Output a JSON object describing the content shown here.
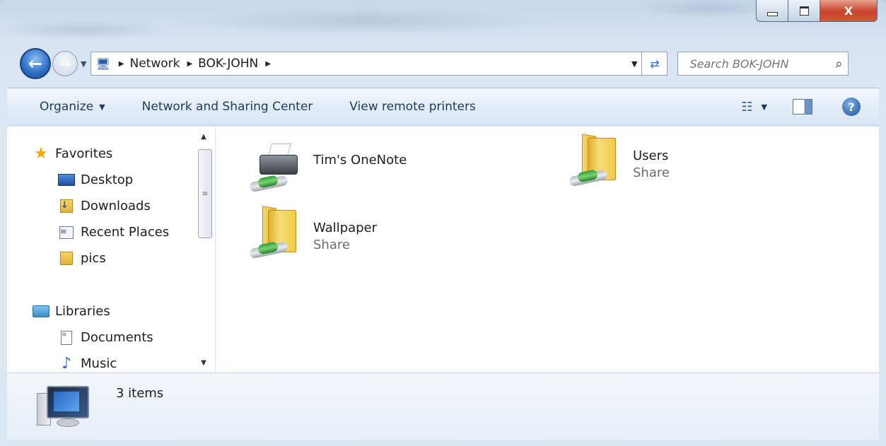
{
  "window": {
    "caption": {
      "minimize": "–",
      "maximize": "□",
      "close": "X"
    }
  },
  "navigation": {
    "breadcrumbs": [
      "Network",
      "BOK-JOHN"
    ],
    "search_placeholder": "Search BOK-JOHN"
  },
  "toolbar": {
    "organize": "Organize",
    "network_sharing": "Network and Sharing Center",
    "view_remote_printers": "View remote printers"
  },
  "sidebar": {
    "favorites": {
      "label": "Favorites",
      "items": [
        {
          "label": "Desktop",
          "icon": "desktop-icon"
        },
        {
          "label": "Downloads",
          "icon": "downloads-icon"
        },
        {
          "label": "Recent Places",
          "icon": "recent-places-icon"
        },
        {
          "label": "pics",
          "icon": "folder-icon"
        }
      ]
    },
    "libraries": {
      "label": "Libraries",
      "items": [
        {
          "label": "Documents",
          "icon": "documents-icon"
        },
        {
          "label": "Music",
          "icon": "music-icon"
        }
      ]
    }
  },
  "content": {
    "items": [
      {
        "name": "Tim's OneNote",
        "type": "",
        "icon": "network-printer-icon"
      },
      {
        "name": "Users",
        "type": "Share",
        "icon": "shared-folder-icon"
      },
      {
        "name": "Wallpaper",
        "type": "Share",
        "icon": "shared-folder-icon"
      }
    ]
  },
  "status": {
    "count": "3 items"
  },
  "colors": {
    "accent": "#2a6cc6",
    "command_text": "#1e3a5f",
    "secondary_text": "#6d6d6d"
  }
}
